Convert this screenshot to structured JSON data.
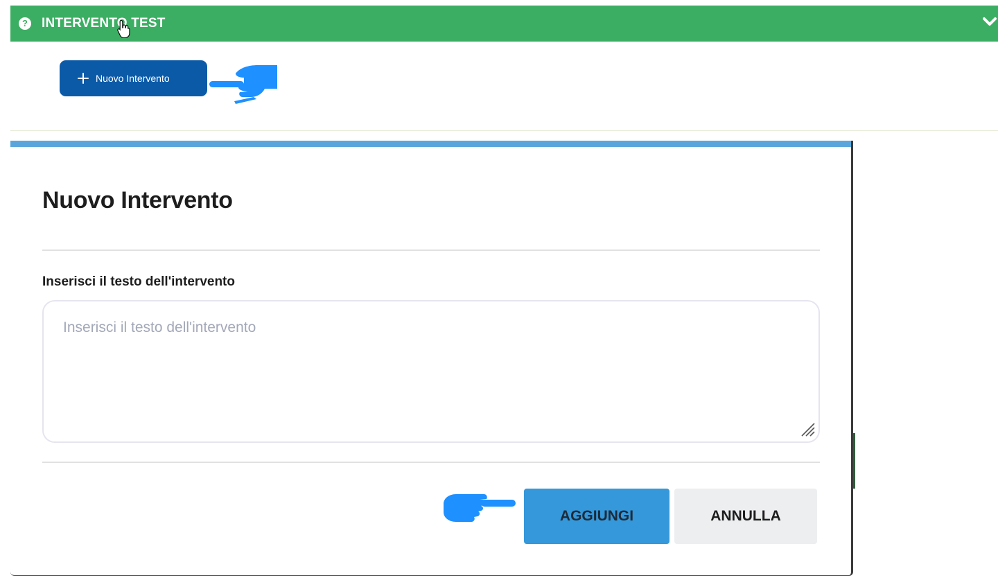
{
  "accordion": {
    "title": "INTERVENTO TEST",
    "help_icon": "question-circle-icon",
    "chevron_icon": "chevron-down-icon",
    "color": "#3cae63"
  },
  "toolbar": {
    "new_button_label": "Nuovo Intervento",
    "new_button_icon": "plus-icon",
    "new_button_color": "#0b5aa8"
  },
  "annotations": {
    "pointer_hand_icon": "pointing-hand-icon",
    "pointer_color": "#1e90ff"
  },
  "modal": {
    "title": "Nuovo Intervento",
    "field_label": "Inserisci il testo dell'intervento",
    "textarea_placeholder": "Inserisci il testo dell'intervento",
    "textarea_value": "",
    "accent_color": "#5aa6dc",
    "buttons": {
      "add": "AGGIUNGI",
      "cancel": "ANNULLA"
    }
  }
}
